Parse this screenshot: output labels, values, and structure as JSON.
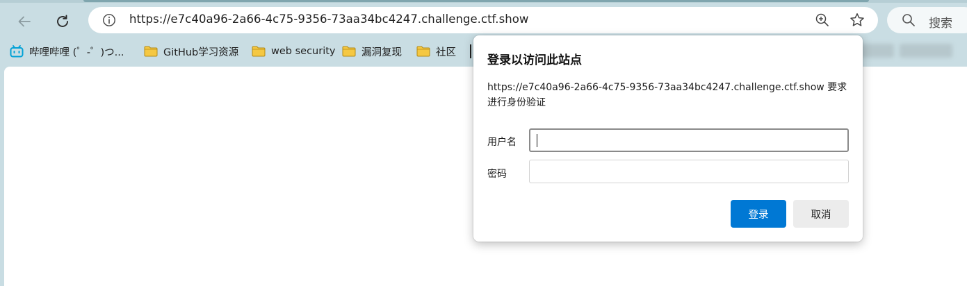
{
  "browser": {
    "url": "https://e7c40a96-2a66-4c75-9356-73aa34bc4247.challenge.ctf.show",
    "search_label": "搜索",
    "icons": [
      "back-arrow-icon",
      "refresh-icon",
      "info-icon",
      "zoom-icon",
      "favorite-star-icon",
      "search-icon"
    ]
  },
  "bookmarks": [
    {
      "label": "哔哩哔哩 (゜-゜)つ...",
      "icon": "bilibili-icon"
    },
    {
      "label": "GitHub学习资源",
      "icon": "folder-icon"
    },
    {
      "label": "web security",
      "icon": "folder-icon"
    },
    {
      "label": "漏洞复现",
      "icon": "folder-icon"
    },
    {
      "label": "社区",
      "icon": "folder-icon"
    }
  ],
  "dialog": {
    "title": "登录以访问此站点",
    "description": "https://e7c40a96-2a66-4c75-9356-73aa34bc4247.challenge.ctf.show 要求进行身份验证",
    "username_label": "用户名",
    "username_value": "",
    "password_label": "密码",
    "password_value": "",
    "login_button": "登录",
    "cancel_button": "取消"
  },
  "colors": {
    "chrome_bg": "#c9dde3",
    "primary_button": "#0078d4",
    "folder": "#f5c842"
  }
}
